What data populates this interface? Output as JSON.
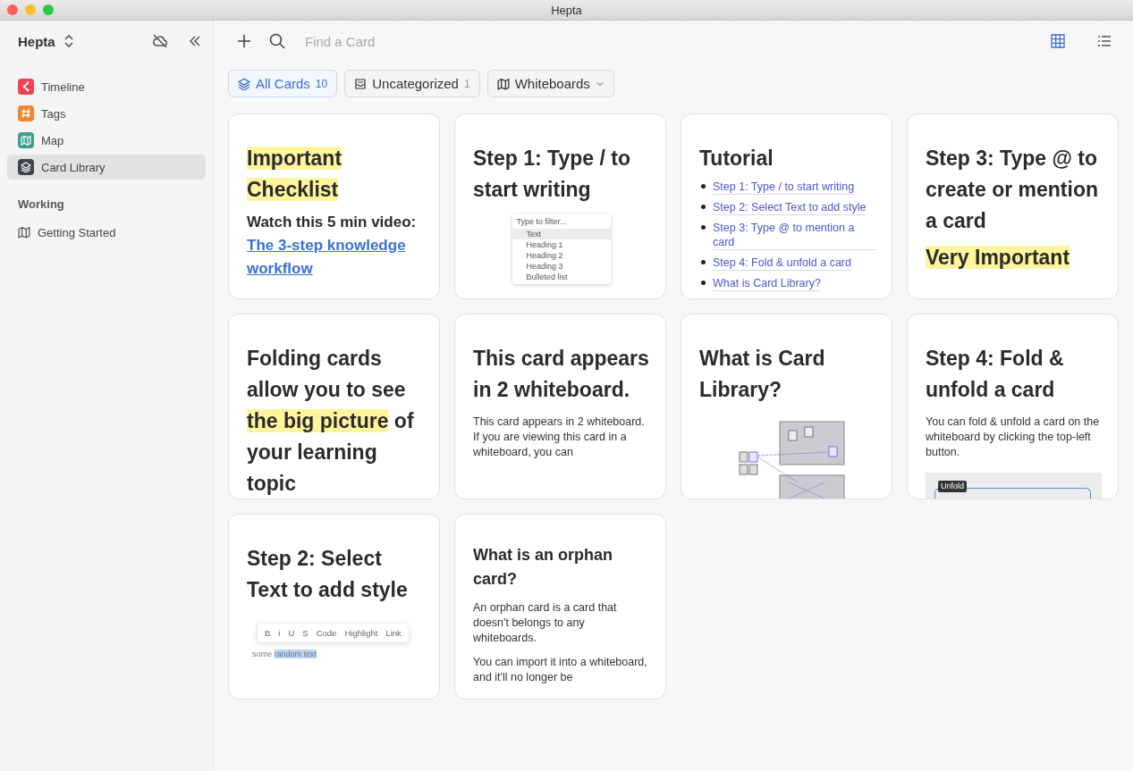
{
  "window": {
    "title": "Hepta"
  },
  "sidebar": {
    "workspace": "Hepta",
    "items": [
      {
        "label": "Timeline",
        "kind": "timeline",
        "color": "#f0424f",
        "selected": false
      },
      {
        "label": "Tags",
        "kind": "tag",
        "color": "#f0862e",
        "selected": false
      },
      {
        "label": "Map",
        "kind": "map",
        "color": "#3e9e8c",
        "selected": false
      },
      {
        "label": "Card Library",
        "kind": "layers",
        "color": "#3c4450",
        "selected": true
      }
    ],
    "section": {
      "title": "Working",
      "items": [
        {
          "label": "Getting Started",
          "selected": false
        }
      ]
    }
  },
  "toolbar": {
    "search": {
      "placeholder": "Find a Card"
    },
    "views": [
      {
        "kind": "grid",
        "selected": true
      },
      {
        "kind": "list",
        "selected": false
      }
    ]
  },
  "filters": [
    {
      "label": "All Cards",
      "kind": "layers",
      "count": "10",
      "selected": true
    },
    {
      "label": "Uncategorized",
      "kind": "inbox",
      "count": "1",
      "selected": false
    },
    {
      "label": "Whiteboards",
      "kind": "map",
      "dropdown": true,
      "selected": false
    }
  ],
  "cards": [
    {
      "blocks": [
        {
          "kind": "title",
          "parts": [
            {
              "text": "Important Checklist",
              "highlight": true
            }
          ]
        },
        {
          "kind": "video",
          "text": "Watch this 5 min video:",
          "link": "The 3-step knowledge workflow"
        }
      ]
    },
    {
      "blocks": [
        {
          "kind": "title",
          "parts": [
            {
              "text": "Step 1: Type / to start writing",
              "highlight": false
            }
          ]
        },
        {
          "kind": "slash-menu",
          "filter": "Type to filter...",
          "items": [
            {
              "label": "Text",
              "selected": true
            },
            {
              "label": "Heading 1",
              "selected": false
            },
            {
              "label": "Heading 2",
              "selected": false
            },
            {
              "label": "Heading 3",
              "selected": false
            },
            {
              "label": "Bulleted list",
              "selected": false
            }
          ]
        }
      ]
    },
    {
      "blocks": [
        {
          "kind": "title",
          "parts": [
            {
              "text": "Tutorial",
              "highlight": false
            }
          ]
        },
        {
          "kind": "links",
          "items": [
            "Step 1: Type / to start writing",
            "Step 2: Select Text to add style",
            "Step 3: Type @ to mention a card",
            "Step 4: Fold & unfold a card",
            "What is Card Library?"
          ]
        }
      ]
    },
    {
      "blocks": [
        {
          "kind": "title",
          "parts": [
            {
              "text": "Step 3: Type @ to create or mention a card",
              "highlight": false
            }
          ]
        },
        {
          "kind": "title",
          "parts": [
            {
              "text": "Very Important",
              "highlight": true
            }
          ]
        }
      ]
    },
    {
      "blocks": [
        {
          "kind": "title",
          "parts": [
            {
              "text": "Folding cards allow you to see ",
              "highlight": false
            },
            {
              "text": "the big picture",
              "highlight": true
            },
            {
              "text": " of your learning topic",
              "highlight": false
            }
          ]
        }
      ]
    },
    {
      "blocks": [
        {
          "kind": "title",
          "parts": [
            {
              "text": "This card appears in 2 whiteboard.",
              "highlight": false
            }
          ]
        },
        {
          "kind": "text",
          "text": "This card appears in 2 whiteboard. If you are viewing this card in a whiteboard, you can"
        }
      ]
    },
    {
      "blocks": [
        {
          "kind": "title",
          "parts": [
            {
              "text": "What is Card Library?",
              "highlight": false
            }
          ]
        },
        {
          "kind": "diagram"
        }
      ]
    },
    {
      "blocks": [
        {
          "kind": "title",
          "parts": [
            {
              "text": "Step 4: Fold & unfold a card",
              "highlight": false
            }
          ]
        },
        {
          "kind": "text",
          "text": "You can fold & unfold a card on the whiteboard by clicking the top-left button."
        },
        {
          "kind": "unfold",
          "label": "Unfold"
        }
      ]
    },
    {
      "blocks": [
        {
          "kind": "title",
          "parts": [
            {
              "text": "Step 2: Select Text to add style",
              "highlight": false
            }
          ]
        },
        {
          "kind": "format-bar",
          "buttons": [
            "B",
            "i",
            "U",
            "S",
            "Code",
            "Highlight",
            "Link"
          ],
          "sample": "some",
          "selection": "random text"
        }
      ]
    },
    {
      "blocks": [
        {
          "kind": "subtitle",
          "parts": [
            {
              "text": "What is an orphan card?",
              "highlight": false
            }
          ]
        },
        {
          "kind": "text",
          "text": "An orphan card is a card that doesn't belongs to any whiteboards."
        },
        {
          "kind": "text",
          "text": "You can import it into a whiteboard, and it'll no longer be"
        }
      ]
    }
  ]
}
